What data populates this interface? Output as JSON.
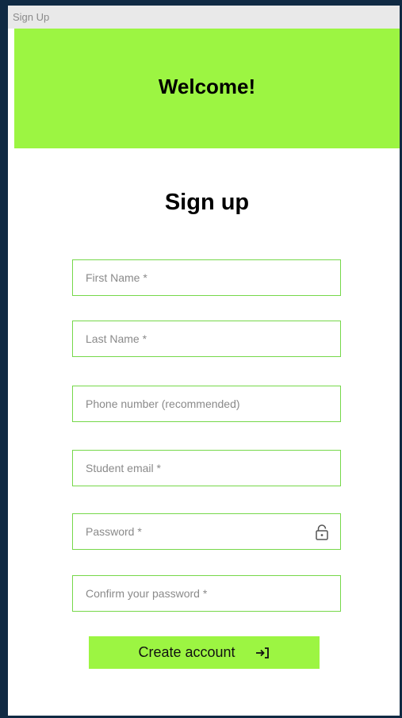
{
  "window": {
    "title": "Sign Up"
  },
  "banner": {
    "text": "Welcome!"
  },
  "form": {
    "heading": "Sign up",
    "fields": [
      {
        "placeholder": "First Name *"
      },
      {
        "placeholder": "Last Name *"
      },
      {
        "placeholder": "Phone number (recommended)"
      },
      {
        "placeholder": "Student email *"
      },
      {
        "placeholder": "Password *"
      },
      {
        "placeholder": "Confirm your password *"
      }
    ],
    "submit_label": "Create account"
  },
  "icons": {
    "password": "lock-icon",
    "submit": "sign-in-arrow-icon"
  },
  "colors": {
    "accent": "#9cf542",
    "field_border": "#76d84a",
    "background": "#102a43"
  }
}
